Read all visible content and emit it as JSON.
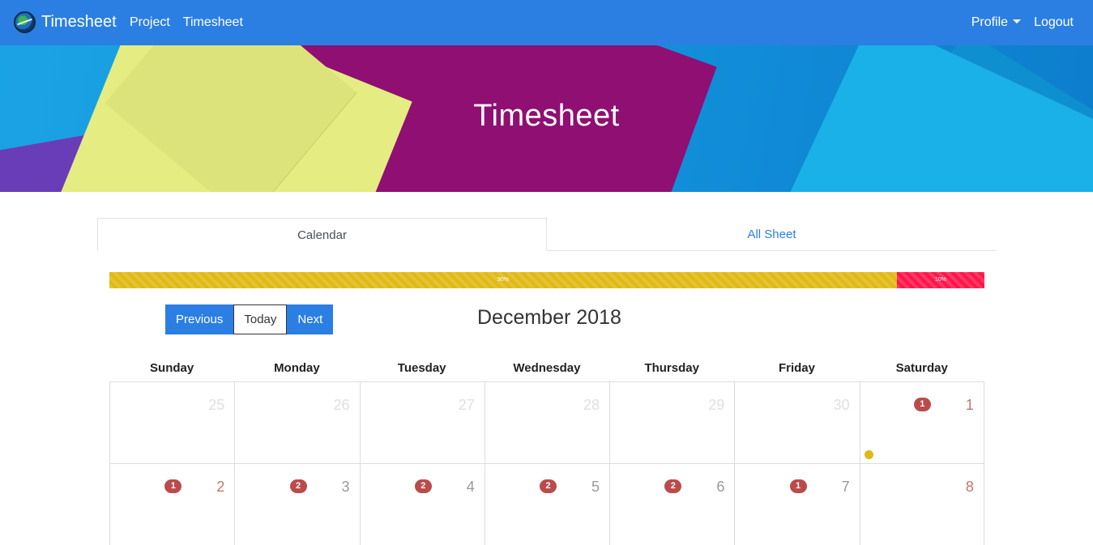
{
  "navbar": {
    "brand": "Timesheet",
    "links": [
      "Project",
      "Timesheet"
    ],
    "profile_label": "Profile",
    "logout_label": "Logout"
  },
  "hero": {
    "title": "Timesheet"
  },
  "tabs": [
    {
      "label": "Calendar",
      "active": true
    },
    {
      "label": "All Sheet",
      "active": false
    }
  ],
  "progress": [
    {
      "label": "90%",
      "value": 0.9,
      "color": "#e0b913"
    },
    {
      "label": "10%",
      "value": 0.1,
      "color": "#ff1549"
    }
  ],
  "calendar": {
    "buttons": {
      "previous": "Previous",
      "today": "Today",
      "next": "Next"
    },
    "month_title": "December 2018",
    "day_names": [
      "Sunday",
      "Monday",
      "Tuesday",
      "Wednesday",
      "Thursday",
      "Friday",
      "Saturday"
    ],
    "weeks": [
      [
        {
          "date": "25",
          "other_month": true,
          "badge": ""
        },
        {
          "date": "26",
          "other_month": true,
          "badge": ""
        },
        {
          "date": "27",
          "other_month": true,
          "badge": ""
        },
        {
          "date": "28",
          "other_month": true,
          "badge": ""
        },
        {
          "date": "29",
          "other_month": true,
          "badge": ""
        },
        {
          "date": "30",
          "other_month": true,
          "badge": ""
        },
        {
          "date": "1",
          "other_month": false,
          "badge": "1",
          "weekend": true,
          "event_dot": true
        }
      ],
      [
        {
          "date": "2",
          "other_month": false,
          "badge": "1",
          "weekend": true
        },
        {
          "date": "3",
          "other_month": false,
          "badge": "2"
        },
        {
          "date": "4",
          "other_month": false,
          "badge": "2"
        },
        {
          "date": "5",
          "other_month": false,
          "badge": "2"
        },
        {
          "date": "6",
          "other_month": false,
          "badge": "2"
        },
        {
          "date": "7",
          "other_month": false,
          "badge": "1"
        },
        {
          "date": "8",
          "other_month": false,
          "badge": "",
          "weekend": true
        }
      ]
    ]
  }
}
